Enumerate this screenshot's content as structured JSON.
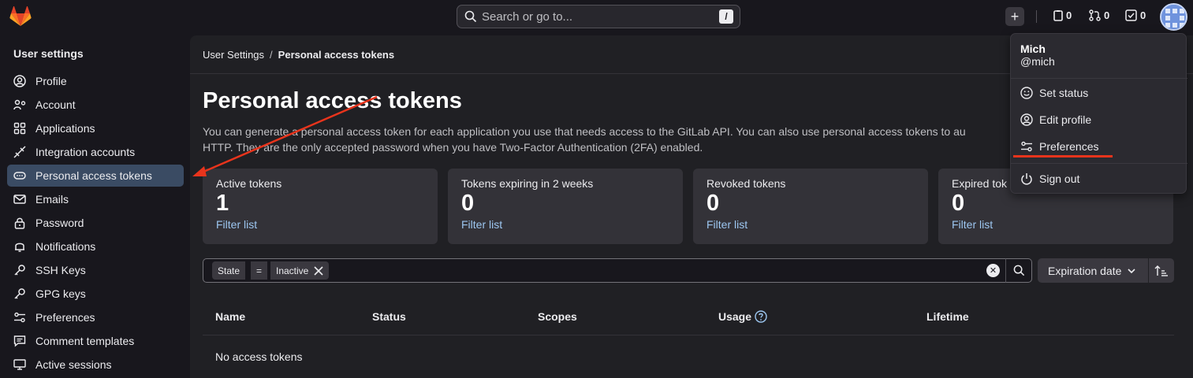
{
  "header": {
    "search_placeholder": "Search or go to...",
    "search_shortcut": "/",
    "issues_count": "0",
    "merge_requests_count": "0",
    "todos_count": "0"
  },
  "sidebar": {
    "title": "User settings",
    "items": [
      {
        "label": "Profile",
        "icon": "profile-icon"
      },
      {
        "label": "Account",
        "icon": "account-icon"
      },
      {
        "label": "Applications",
        "icon": "applications-icon"
      },
      {
        "label": "Integration accounts",
        "icon": "integration-icon"
      },
      {
        "label": "Personal access tokens",
        "icon": "token-icon",
        "active": true
      },
      {
        "label": "Emails",
        "icon": "mail-icon"
      },
      {
        "label": "Password",
        "icon": "lock-icon"
      },
      {
        "label": "Notifications",
        "icon": "bell-icon"
      },
      {
        "label": "SSH Keys",
        "icon": "key-icon"
      },
      {
        "label": "GPG keys",
        "icon": "key-icon"
      },
      {
        "label": "Preferences",
        "icon": "preferences-icon"
      },
      {
        "label": "Comment templates",
        "icon": "comment-icon"
      },
      {
        "label": "Active sessions",
        "icon": "monitor-icon"
      }
    ]
  },
  "main": {
    "breadcrumb": {
      "parent": "User Settings",
      "separator": "/",
      "current": "Personal access tokens"
    },
    "title": "Personal access tokens",
    "description": "You can generate a personal access token for each application you use that needs access to the GitLab API. You can also use personal access tokens to au",
    "description_line2": "HTTP. They are the only accepted password when you have Two-Factor Authentication (2FA) enabled.",
    "stats": [
      {
        "label": "Active tokens",
        "value": "1",
        "link": "Filter list"
      },
      {
        "label": "Tokens expiring in 2 weeks",
        "value": "0",
        "link": "Filter list"
      },
      {
        "label": "Revoked tokens",
        "value": "0",
        "link": "Filter list"
      },
      {
        "label": "Expired tok",
        "value": "0",
        "link": "Filter list"
      }
    ],
    "filter": {
      "token_field": "State",
      "token_operator": "=",
      "token_value": "Inactive"
    },
    "sort": {
      "label": "Expiration date"
    },
    "table": {
      "columns": [
        "Name",
        "Status",
        "Scopes",
        "Usage",
        "Lifetime"
      ],
      "empty_text": "No access tokens"
    }
  },
  "user_menu": {
    "name": "Mich",
    "handle": "@mich",
    "items": [
      "Set status",
      "Edit profile",
      "Preferences",
      "Sign out"
    ]
  },
  "colors": {
    "accent_annotation": "#e8341c",
    "active_nav": "#3a4b63",
    "link": "#9dc7f1"
  }
}
